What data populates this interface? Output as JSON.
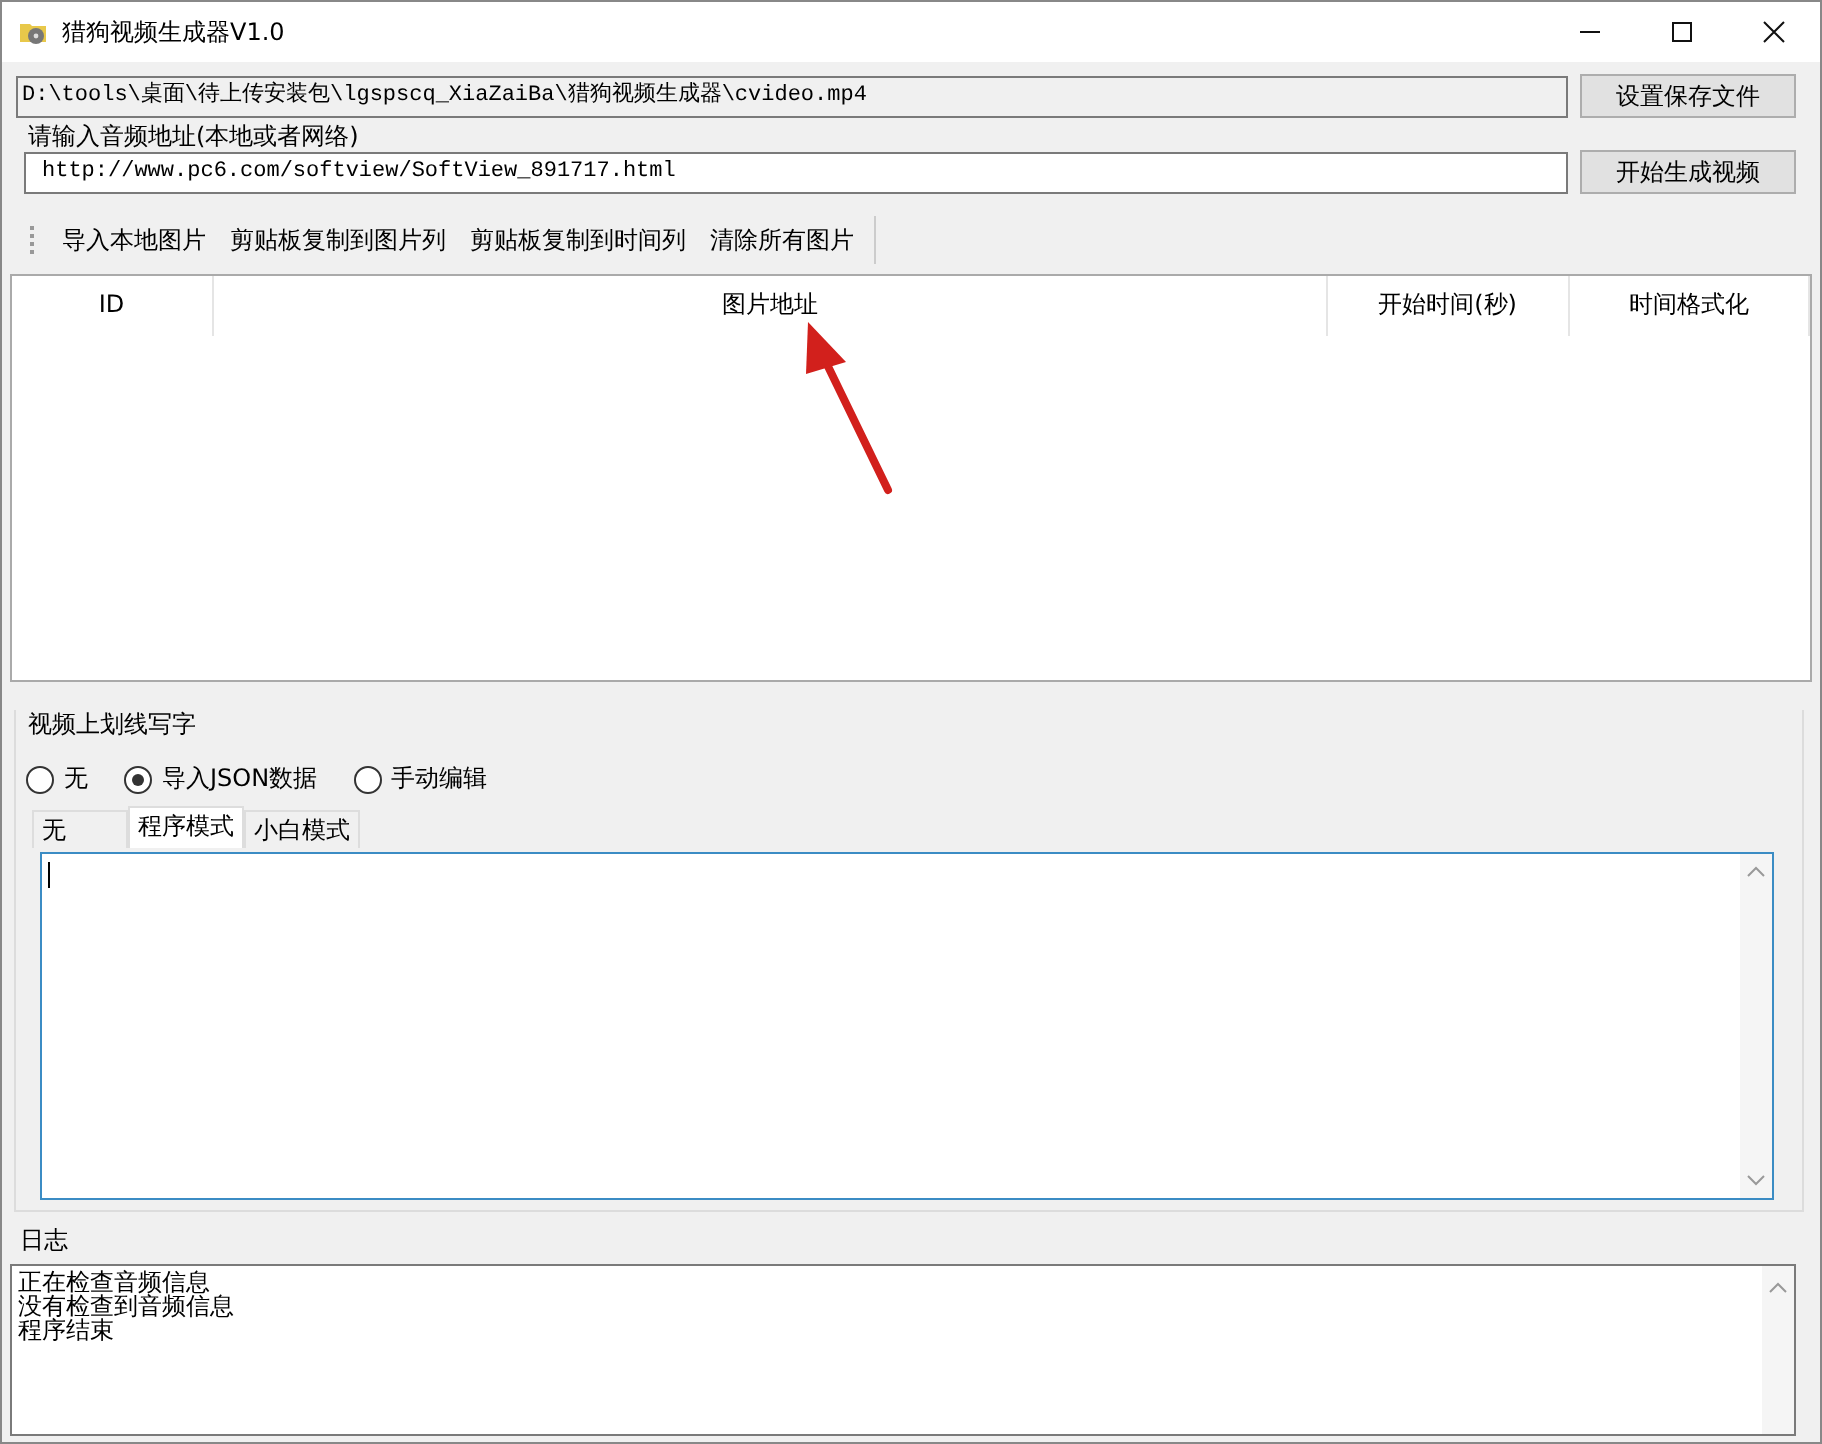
{
  "window": {
    "title": "猎狗视频生成器V1.0"
  },
  "output": {
    "value": "D:\\tools\\桌面\\待上传安装包\\lgspscq_XiaZaiBa\\猎狗视频生成器\\cvideo.mp4",
    "button": "设置保存文件"
  },
  "audio": {
    "label": "请输入音频地址(本地或者网络)",
    "value": "http://www.pc6.com/softview/SoftView_891717.html",
    "button": "开始生成视频"
  },
  "toolbar": [
    "导入本地图片",
    "剪贴板复制到图片列",
    "剪贴板复制到时间列",
    "清除所有图片"
  ],
  "table": {
    "columns": [
      "ID",
      "图片地址",
      "开始时间(秒)",
      "时间格式化"
    ]
  },
  "overlay": {
    "title": "视频上划线写字",
    "radios": [
      {
        "label": "无",
        "selected": false
      },
      {
        "label": "导入JSON数据",
        "selected": true
      },
      {
        "label": "手动编辑",
        "selected": false
      }
    ],
    "tabs": [
      {
        "label": "无",
        "selected": false
      },
      {
        "label": "程序模式",
        "selected": true
      },
      {
        "label": "小白模式",
        "selected": false
      }
    ]
  },
  "log": {
    "title": "日志",
    "lines": [
      "正在检查音频信息",
      "没有检查到音频信息",
      "程序结束"
    ]
  }
}
